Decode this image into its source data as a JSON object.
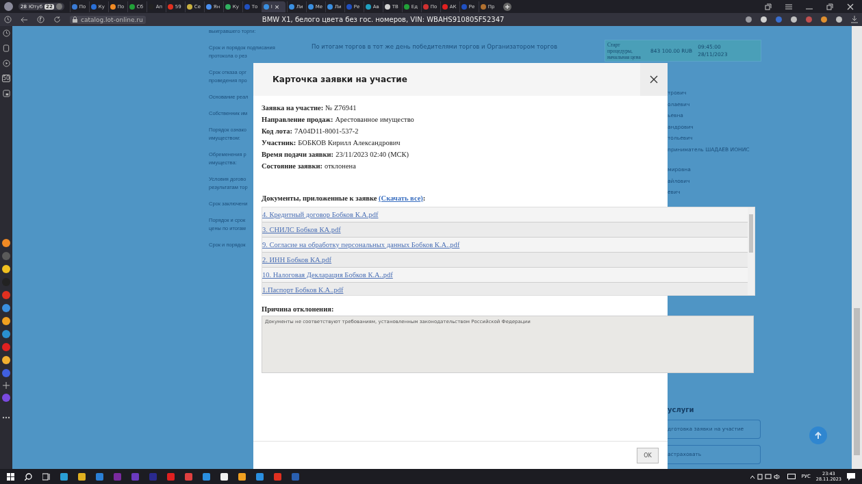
{
  "browser": {
    "group": {
      "count": "28",
      "label": "Ютуб",
      "badge": "22"
    },
    "tabs": [
      {
        "label": "По",
        "color": "#3a7bd5",
        "selected": false
      },
      {
        "label": "Ку",
        "color": "#2a6fd6",
        "selected": false
      },
      {
        "label": "По",
        "color": "#f08a24",
        "selected": false
      },
      {
        "label": "Сб",
        "color": "#21a038",
        "selected": false
      },
      {
        "label": "Ап",
        "color": "#222222",
        "selected": false
      },
      {
        "label": "59",
        "color": "#e03020",
        "selected": false
      },
      {
        "label": "Се",
        "color": "#c8b040",
        "selected": false
      },
      {
        "label": "Ян",
        "color": "#4a8ff0",
        "selected": false
      },
      {
        "label": "Ку",
        "color": "#30b060",
        "selected": false
      },
      {
        "label": "То",
        "color": "#2050c0",
        "selected": false
      },
      {
        "label": "I",
        "color": "#3a8fe0",
        "selected": true,
        "close": "×"
      },
      {
        "label": "Ли",
        "color": "#3a8fe0",
        "selected": false
      },
      {
        "label": "Ме",
        "color": "#3a8fe0",
        "selected": false
      },
      {
        "label": "Ли",
        "color": "#3a8fe0",
        "selected": false
      },
      {
        "label": "Ре",
        "color": "#2050c0",
        "selected": false
      },
      {
        "label": "Ав",
        "color": "#20a0c0",
        "selected": false
      },
      {
        "label": "ТВ",
        "color": "#d0d0d0",
        "selected": false
      },
      {
        "label": "Ед",
        "color": "#21a038",
        "selected": false
      },
      {
        "label": "По",
        "color": "#d03030",
        "selected": false
      },
      {
        "label": "АК",
        "color": "#e02020",
        "selected": false
      },
      {
        "label": "Ре",
        "color": "#2050c0",
        "selected": false
      },
      {
        "label": "Пр",
        "color": "#b07030",
        "selected": false
      }
    ],
    "url": "catalog.lot-online.ru",
    "page_title": "BMW X1, белого цвета без гос. номеров, VIN: WBAHS910805F52347",
    "side_badge": "50"
  },
  "page": {
    "labels": [
      "выигравшего торги:",
      "Срок и порядок подписания\nпротокола о рез",
      "Срок отказа орг\nпроведения про",
      "Основание реал",
      "Собственник им",
      "Порядок ознако\nимуществом:",
      "Обременения р\nимущества:",
      "Условия догово\nрезультатам тор",
      "Срок заключени",
      "Порядок и срок\nцены по итогам",
      "Срок и порядок"
    ],
    "top_value": "По итогам торгов в тот же день победителями торгов и Организатором торгов",
    "start_row": {
      "label": "Старт процедуры,\nначальная цена",
      "price": "843 100.00 RUB",
      "time": "09:45:00",
      "date": "28/11/2023"
    },
    "participants": [
      "трович",
      "олаевич",
      "ьевна",
      "андрович",
      "тольевич",
      "приниматель ШАДАЕВ ИОНИС",
      "мировна",
      "айлович",
      "евич"
    ],
    "services_title": "услуги",
    "service_buttons": [
      "дготовка заявки на участие",
      "астраховать"
    ]
  },
  "dialog": {
    "title": "Карточка заявки на участие",
    "fields": [
      {
        "label": "Заявка на участие:",
        "value": "№ Z76941"
      },
      {
        "label": "Направление продаж:",
        "value": "Арестованное имущество"
      },
      {
        "label": "Код лота:",
        "value": "7A04D11-8001-537-2"
      },
      {
        "label": "Участник:",
        "value": "БОБКОВ Кирилл Александрович"
      },
      {
        "label": "Время подачи заявки:",
        "value": "23/11/2023 02:40 (МСК)"
      },
      {
        "label": "Состояние заявки:",
        "value": "отклонена"
      }
    ],
    "documents_heading": {
      "before": "Документы, приложенные к заявке",
      "link": "(Скачать все)",
      "after": ":"
    },
    "documents": [
      "4. Кредитный договор Бобков К.А.pdf",
      "3. СНИЛС Бобков КА.pdf",
      "9. Согласие на обработку персональных данных Бобков К.А..pdf",
      "2. ИНН Бобков КА.pdf",
      "10. Налоговая Декларация Бобков К.А..pdf",
      "1.Паспорт Бобков К.А..pdf"
    ],
    "reason_label": "Причина отклонения:",
    "reason": "Документы не соответствуют требованиям, установленным законодательством Российской Федерации",
    "ok": "OK"
  },
  "taskbar": {
    "lang": "РУС",
    "time": "23:43",
    "date": "28.11.2023"
  }
}
